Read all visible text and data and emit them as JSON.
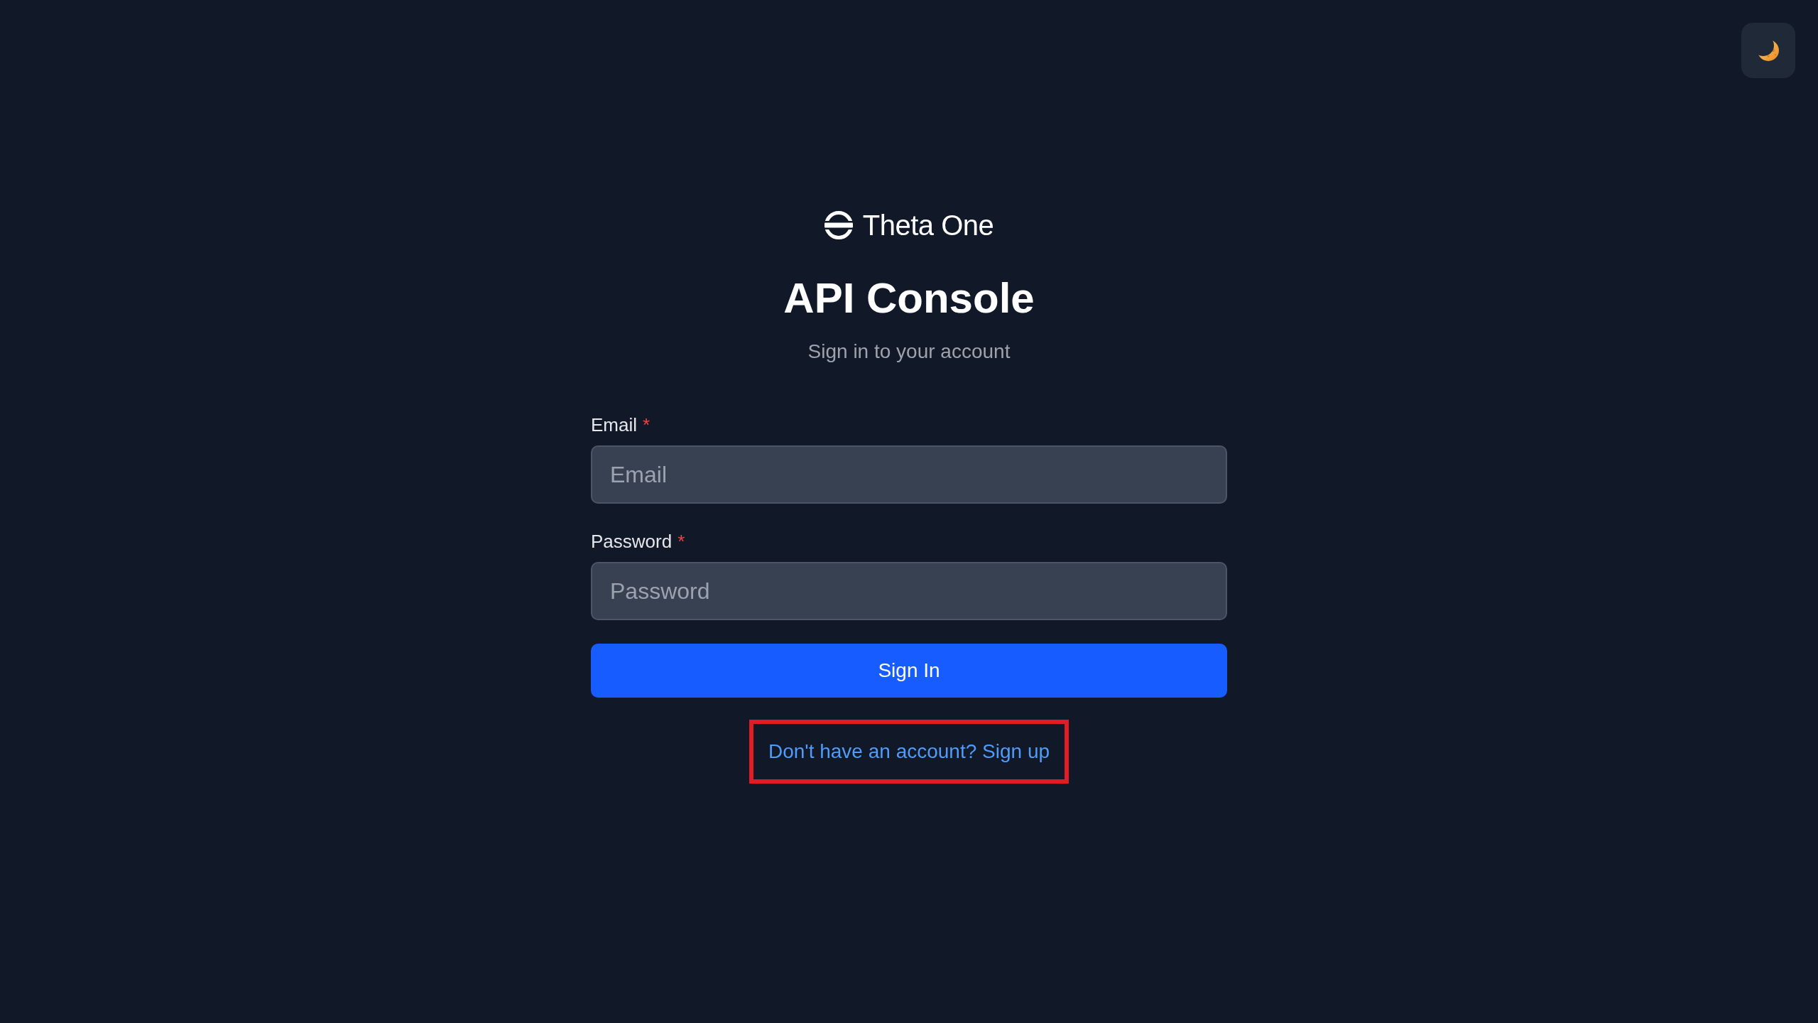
{
  "brand": {
    "name": "Theta One"
  },
  "header": {
    "title": "API Console",
    "subtitle": "Sign in to your account"
  },
  "form": {
    "fields": [
      {
        "label": "Email",
        "required_mark": "*",
        "placeholder": "Email"
      },
      {
        "label": "Password",
        "required_mark": "*",
        "placeholder": "Password"
      }
    ],
    "submit": {
      "label": "Sign In"
    }
  },
  "signup_link": {
    "label": "Don't have an account? Sign up",
    "highlighted": true
  }
}
